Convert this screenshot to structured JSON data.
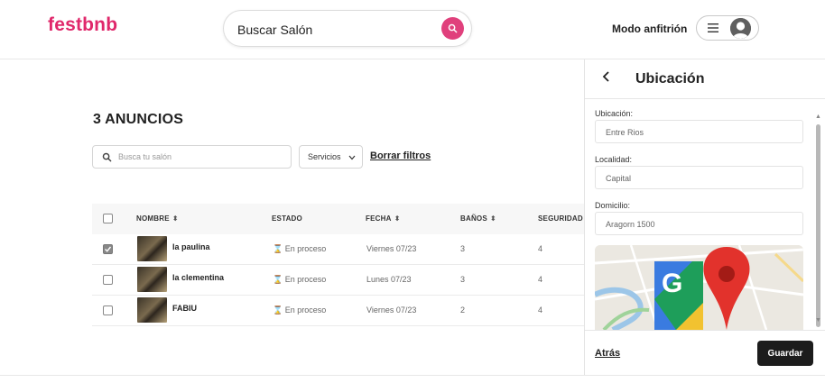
{
  "header": {
    "logo": "festbnb",
    "search_label": "Buscar Salón",
    "host_link": "Modo anfitrión",
    "brand_color": "#e0286b"
  },
  "main": {
    "title": "3 ANUNCIOS",
    "filter_placeholder": "Busca tu salón",
    "services_label": "Servicios",
    "clear_filters": "Borrar filtros",
    "columns": {
      "name": "NOMBRE",
      "status": "ESTADO",
      "date": "FECHA",
      "baths": "BAÑOS",
      "security": "SEGURIDAD"
    },
    "rows": [
      {
        "name": "la paulina",
        "status": "En proceso",
        "date": "Viernes 07/23",
        "baths": "3",
        "security": "4",
        "checked": true
      },
      {
        "name": "la clementina",
        "status": "En proceso",
        "date": "Lunes 07/23",
        "baths": "3",
        "security": "4",
        "checked": false
      },
      {
        "name": "FABIU",
        "status": "En proceso",
        "date": "Viernes 07/23",
        "baths": "2",
        "security": "4",
        "checked": false
      }
    ]
  },
  "panel": {
    "title": "Ubicación",
    "fields": [
      {
        "label": "Ubicación:",
        "value": "Entre Rios"
      },
      {
        "label": "Localidad:",
        "value": "Capital"
      },
      {
        "label": "Domicilio:",
        "value": "Aragorn 1500"
      }
    ],
    "back_label": "Atrás",
    "save_label": "Guardar"
  }
}
